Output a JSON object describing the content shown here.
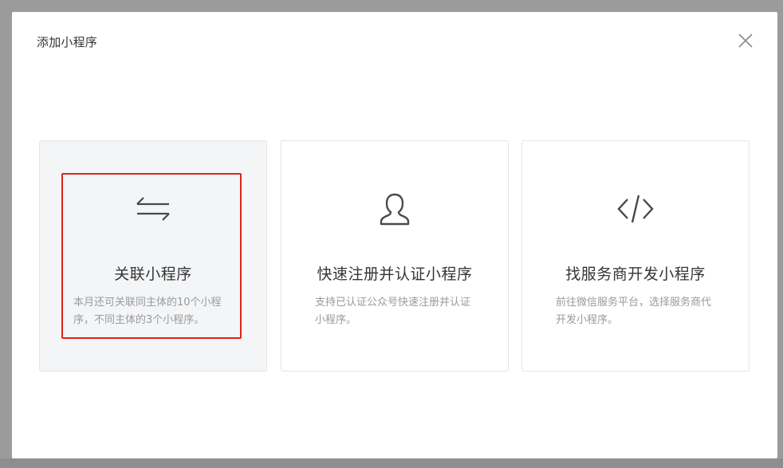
{
  "modal": {
    "title": "添加小程序",
    "close_icon": "close-icon"
  },
  "cards": [
    {
      "icon": "swap-arrows-icon",
      "title": "关联小程序",
      "description": "本月还可关联同主体的10个小程序，不同主体的3个小程序。",
      "selected": true
    },
    {
      "icon": "user-icon",
      "title": "快速注册并认证小程序",
      "description": "支持已认证公众号快速注册并认证小程序。",
      "selected": false
    },
    {
      "icon": "code-icon",
      "title": "找服务商开发小程序",
      "description": "前往微信服务平台，选择服务商代开发小程序。",
      "selected": false
    }
  ],
  "colors": {
    "overlay": "#9b9b9b",
    "modal_bg": "#ffffff",
    "selected_card_bg": "#f4f5f7",
    "card_border": "#e4e4e4",
    "highlight_border": "#e0231a",
    "title_text": "#353535",
    "desc_text": "#9a9a9a"
  }
}
